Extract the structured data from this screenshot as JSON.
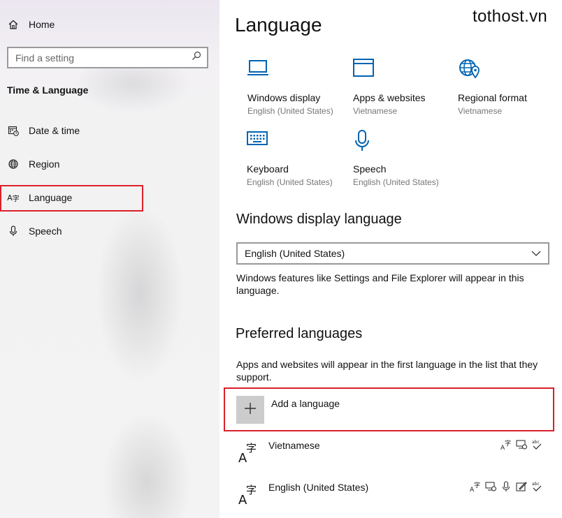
{
  "watermark": "tothost.vn",
  "sidebar": {
    "home_label": "Home",
    "search_placeholder": "Find a setting",
    "section_title": "Time & Language",
    "items": [
      {
        "label": "Date & time",
        "icon": "calendar-clock-icon"
      },
      {
        "label": "Region",
        "icon": "globe-icon"
      },
      {
        "label": "Language",
        "icon": "language-icon",
        "selected": true
      },
      {
        "label": "Speech",
        "icon": "microphone-icon"
      }
    ]
  },
  "main": {
    "title": "Language",
    "tiles": [
      {
        "label": "Windows display",
        "sub": "English (United States)",
        "icon": "monitor-icon"
      },
      {
        "label": "Apps & websites",
        "sub": "Vietnamese",
        "icon": "window-icon"
      },
      {
        "label": "Regional format",
        "sub": "Vietnamese",
        "icon": "globe-pin-icon"
      },
      {
        "label": "Keyboard",
        "sub": "English (United States)",
        "icon": "keyboard-icon"
      },
      {
        "label": "Speech",
        "sub": "English (United States)",
        "icon": "microphone-icon"
      }
    ],
    "display_language": {
      "heading": "Windows display language",
      "selected": "English (United States)",
      "description": "Windows features like Settings and File Explorer will appear in this language."
    },
    "preferred": {
      "heading": "Preferred languages",
      "description": "Apps and websites will appear in the first language in the list that they support.",
      "add_label": "Add a language",
      "languages": [
        {
          "name": "Vietnamese",
          "capabilities": [
            "language-pack-icon",
            "display-icon",
            "spell-check-icon"
          ]
        },
        {
          "name": "English (United States)",
          "capabilities": [
            "language-pack-icon",
            "display-icon",
            "speech-icon",
            "handwriting-icon",
            "spell-check-icon"
          ]
        }
      ]
    }
  },
  "colors": {
    "highlight": "#d9202a",
    "accent": "#0063b1",
    "sidebar_bg": "#f2f2f2"
  }
}
